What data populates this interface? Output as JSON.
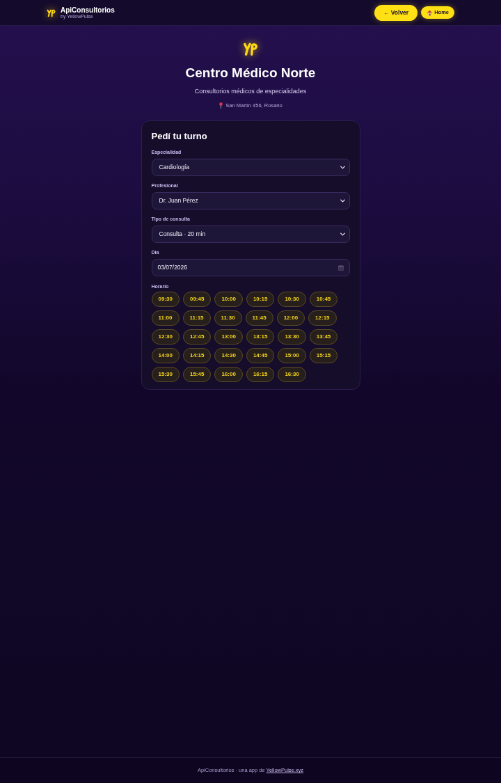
{
  "header": {
    "app_name": "ApiConsultorios",
    "byline": "by YellowPulse",
    "buttons": [
      {
        "label": "← Volver",
        "kind": "back"
      },
      {
        "label": "Home",
        "kind": "home"
      }
    ]
  },
  "hero": {
    "title": "Centro Médico Norte",
    "subtitle": "Consultorios médicos de especialidades",
    "address": "San Martín 456, Rosario"
  },
  "form": {
    "title": "Pedí tu turno",
    "fields": [
      {
        "label": "Especialidad",
        "kind": "select",
        "value": "Cardiología"
      },
      {
        "label": "Profesional",
        "kind": "select",
        "value": "Dr. Juan Pérez"
      },
      {
        "label": "Tipo de consulta",
        "kind": "select",
        "value": "Consulta · 20 min"
      },
      {
        "label": "Día",
        "kind": "date",
        "value": "03/07/2026"
      }
    ],
    "slots_label": "Horario",
    "slots": [
      {
        "time": "09:30",
        "selected": false
      },
      {
        "time": "09:45",
        "selected": false
      },
      {
        "time": "10:00",
        "selected": false
      },
      {
        "time": "10:15",
        "selected": false
      },
      {
        "time": "10:30",
        "selected": false
      },
      {
        "time": "10:45",
        "selected": false
      },
      {
        "time": "11:00",
        "selected": false
      },
      {
        "time": "11:15",
        "selected": false
      },
      {
        "time": "11:30",
        "selected": false
      },
      {
        "time": "11:45",
        "selected": false
      },
      {
        "time": "12:00",
        "selected": false
      },
      {
        "time": "12:15",
        "selected": false
      },
      {
        "time": "12:30",
        "selected": false
      },
      {
        "time": "12:45",
        "selected": false
      },
      {
        "time": "13:00",
        "selected": false
      },
      {
        "time": "13:15",
        "selected": false
      },
      {
        "time": "13:30",
        "selected": false
      },
      {
        "time": "13:45",
        "selected": false
      },
      {
        "time": "14:00",
        "selected": false
      },
      {
        "time": "14:15",
        "selected": false
      },
      {
        "time": "14:30",
        "selected": false
      },
      {
        "time": "14:45",
        "selected": false
      },
      {
        "time": "15:00",
        "selected": false
      },
      {
        "time": "15:15",
        "selected": false
      },
      {
        "time": "15:30",
        "selected": false
      },
      {
        "time": "15:45",
        "selected": false
      },
      {
        "time": "16:00",
        "selected": false
      },
      {
        "time": "16:15",
        "selected": false
      },
      {
        "time": "16:30",
        "selected": false
      }
    ]
  },
  "footer": {
    "text": "ApiConsultorios · una app de ",
    "link": "YellowPulse.xyz"
  }
}
